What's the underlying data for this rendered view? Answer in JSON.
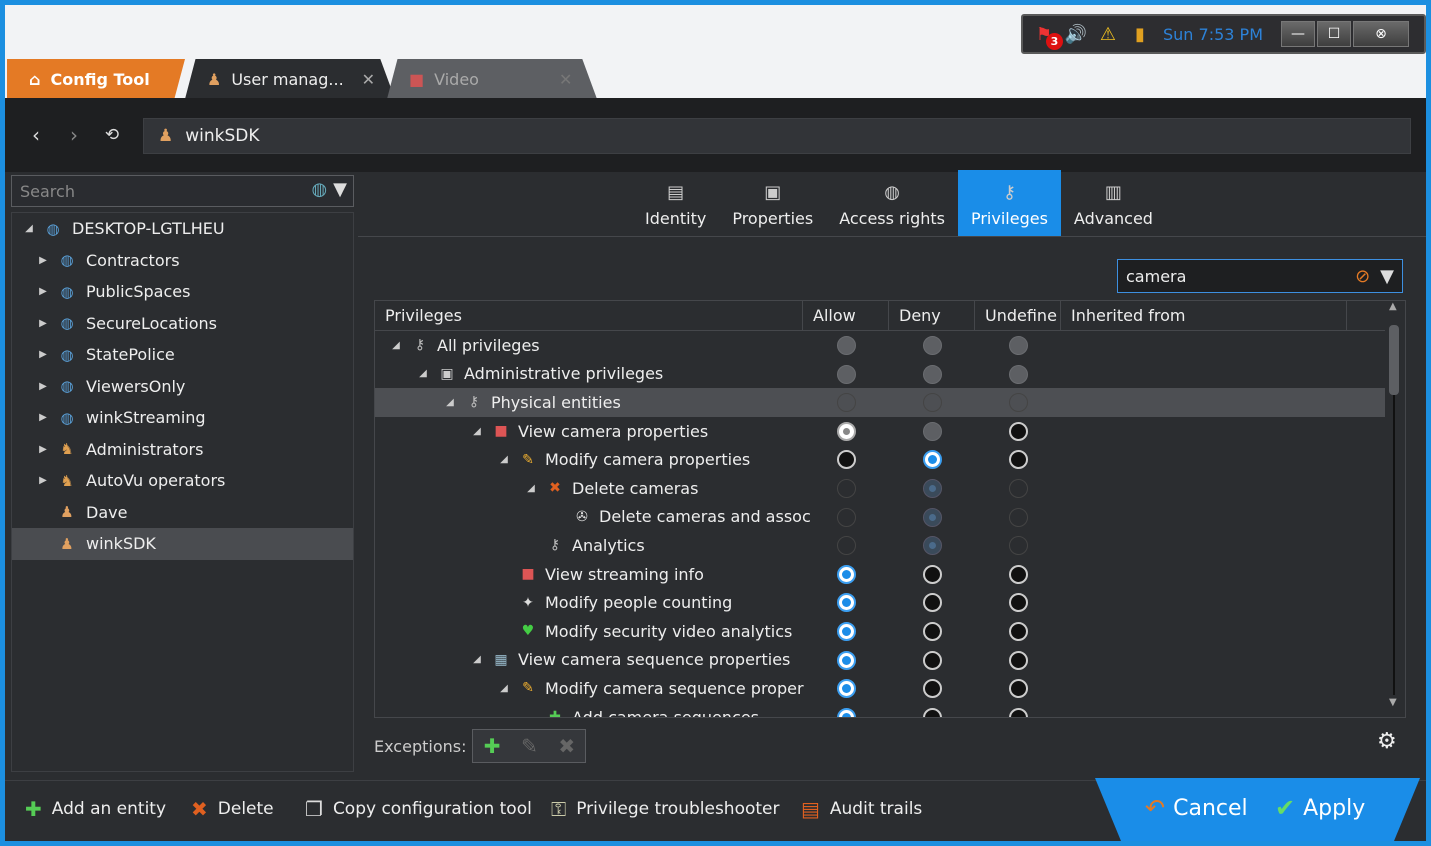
{
  "tray": {
    "alarm_count": "3",
    "clock": "Sun 7:53 PM"
  },
  "tabs": {
    "home": "Config Tool",
    "user": "User manag...",
    "video": "Video"
  },
  "nav": {
    "address": "winkSDK"
  },
  "left": {
    "search_placeholder": "Search",
    "tree": [
      {
        "label": "DESKTOP-LGTLHEU",
        "level": 0,
        "arrow": "▲",
        "icon": "globe"
      },
      {
        "label": "Contractors",
        "level": 1,
        "arrow": "▶",
        "icon": "globe"
      },
      {
        "label": "PublicSpaces",
        "level": 1,
        "arrow": "▶",
        "icon": "globe"
      },
      {
        "label": "SecureLocations",
        "level": 1,
        "arrow": "▶",
        "icon": "globe"
      },
      {
        "label": "StatePolice",
        "level": 1,
        "arrow": "▶",
        "icon": "globe"
      },
      {
        "label": "ViewersOnly",
        "level": 1,
        "arrow": "▶",
        "icon": "globe"
      },
      {
        "label": "winkStreaming",
        "level": 1,
        "arrow": "▶",
        "icon": "globe"
      },
      {
        "label": "Administrators",
        "level": 1,
        "arrow": "▶",
        "icon": "group"
      },
      {
        "label": "AutoVu operators",
        "level": 1,
        "arrow": "▶",
        "icon": "group"
      },
      {
        "label": "Dave",
        "level": 1,
        "arrow": "",
        "icon": "user"
      },
      {
        "label": "winkSDK",
        "level": 1,
        "arrow": "",
        "icon": "user",
        "selected": true
      }
    ]
  },
  "ptabs": [
    "Identity",
    "Properties",
    "Access rights",
    "Privileges",
    "Advanced"
  ],
  "active_tab": "Privileges",
  "filter": {
    "value": "camera"
  },
  "grid": {
    "headers": [
      "Privileges",
      "Allow",
      "Deny",
      "Undefine",
      "Inherited from"
    ],
    "rows": [
      {
        "label": "All privileges",
        "indent": 0,
        "arrow": "◢",
        "icon": "key",
        "allow": "grey",
        "deny": "grey",
        "undef": "grey"
      },
      {
        "label": "Administrative privileges",
        "indent": 1,
        "arrow": "◢",
        "icon": "admin",
        "allow": "grey",
        "deny": "grey",
        "undef": "grey"
      },
      {
        "label": "Physical entities",
        "indent": 2,
        "arrow": "◢",
        "icon": "key",
        "allow": "dim",
        "deny": "dim",
        "undef": "dim",
        "highlight": true
      },
      {
        "label": "View camera properties",
        "indent": 3,
        "arrow": "◢",
        "icon": "camera",
        "allow": "white",
        "deny": "grey",
        "undef": "black"
      },
      {
        "label": "Modify camera properties",
        "indent": 4,
        "arrow": "◢",
        "icon": "pencil",
        "allow": "black",
        "deny": "blue",
        "undef": "black"
      },
      {
        "label": "Delete cameras",
        "indent": 5,
        "arrow": "◢",
        "icon": "x",
        "allow": "dim",
        "deny": "dimblue",
        "undef": "dim"
      },
      {
        "label": "Delete cameras and assoc",
        "indent": 6,
        "arrow": "",
        "icon": "reel",
        "allow": "dim",
        "deny": "dimblue",
        "undef": "dim"
      },
      {
        "label": "Analytics",
        "indent": 5,
        "arrow": "",
        "icon": "key",
        "allow": "dim",
        "deny": "dimblue",
        "undef": "dim"
      },
      {
        "label": "View streaming info",
        "indent": 4,
        "arrow": "",
        "icon": "camera",
        "allow": "blue",
        "deny": "black",
        "undef": "black"
      },
      {
        "label": "Modify people counting",
        "indent": 4,
        "arrow": "",
        "icon": "people",
        "allow": "blue",
        "deny": "black",
        "undef": "black"
      },
      {
        "label": "Modify security video analytics",
        "indent": 4,
        "arrow": "",
        "icon": "analytics",
        "allow": "blue",
        "deny": "black",
        "undef": "black"
      },
      {
        "label": "View camera sequence properties",
        "indent": 3,
        "arrow": "◢",
        "icon": "sequence",
        "allow": "blue",
        "deny": "black",
        "undef": "black"
      },
      {
        "label": "Modify camera sequence proper",
        "indent": 4,
        "arrow": "◢",
        "icon": "pencil",
        "allow": "blue",
        "deny": "black",
        "undef": "black"
      },
      {
        "label": "Add camera sequences",
        "indent": 5,
        "arrow": "",
        "icon": "plus",
        "allow": "blue",
        "deny": "black",
        "undef": "black"
      }
    ]
  },
  "exceptions": {
    "label": "Exceptions:"
  },
  "bottom": {
    "add": "Add an entity",
    "delete": "Delete",
    "copy": "Copy configuration tool",
    "trouble": "Privilege troubleshooter",
    "audit": "Audit trails",
    "cancel": "Cancel",
    "apply": "Apply"
  },
  "colors": {
    "accent": "#1a8de8",
    "home_tab": "#e47a25",
    "panel": "#2b2d30"
  }
}
